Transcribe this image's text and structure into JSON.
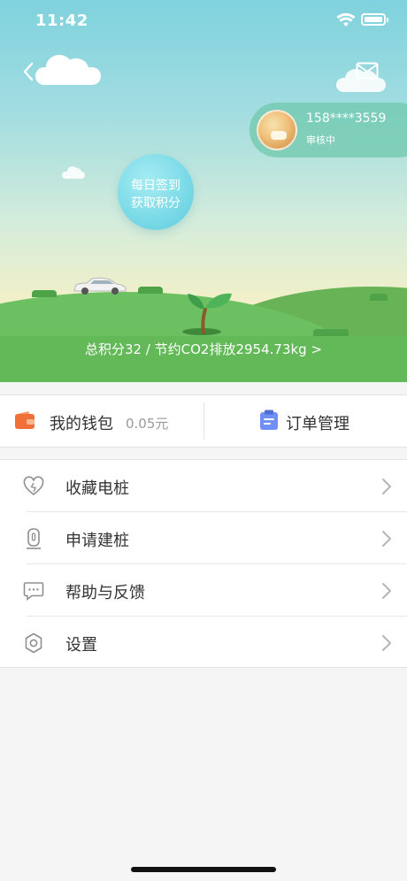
{
  "status_bar": {
    "time": "11:42"
  },
  "user": {
    "phone": "158****3559",
    "status": "审核中"
  },
  "checkin": {
    "line1": "每日签到",
    "line2": "获取积分"
  },
  "points_summary": "总积分32 / 节约CO2排放2954.73kg >",
  "wallet": {
    "label": "我的钱包",
    "balance": "0.05元"
  },
  "orders": {
    "label": "订单管理"
  },
  "menu": {
    "items": [
      {
        "label": "收藏电桩",
        "icon": "heart-icon"
      },
      {
        "label": "申请建桩",
        "icon": "charger-icon"
      },
      {
        "label": "帮助与反馈",
        "icon": "chat-icon"
      },
      {
        "label": "设置",
        "icon": "gear-icon"
      }
    ]
  },
  "colors": {
    "wallet_icon": "#f0703a",
    "orders_icon": "#6f8ff5",
    "hill": "#6cc061",
    "user_chip": "#6ec8aa"
  }
}
